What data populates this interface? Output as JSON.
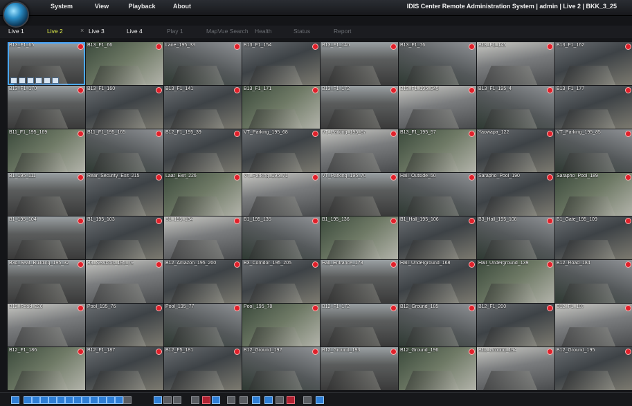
{
  "menu": [
    "System",
    "View",
    "Playback",
    "About"
  ],
  "app_title": "IDIS Center Remote Administration System | admin | Live 2 | BKK_3_25",
  "tabs": [
    {
      "label": "Live 1",
      "state": "normal"
    },
    {
      "label": "Live 2",
      "state": "active"
    },
    {
      "label": "Live 3",
      "state": "normal"
    },
    {
      "label": "Live 4",
      "state": "normal"
    },
    {
      "label": "Play 1",
      "state": "disabled"
    },
    {
      "label": "MapVue Search",
      "state": "disabled"
    },
    {
      "label": "Health",
      "state": "disabled"
    },
    {
      "label": "Status",
      "state": "disabled"
    },
    {
      "label": "Report",
      "state": "disabled"
    }
  ],
  "tab_close": "×",
  "cameras": [
    "B13_F1_65",
    "B13_F1_66",
    "Lane_195_33",
    "B13_F1_154",
    "B13_F1_140",
    "B13_F1_76",
    "B13_F1_145",
    "B13_F1_162",
    "B13_F1_170",
    "B13_F1_160",
    "B13_F1_141",
    "B13_F1_171",
    "B13_F1_172",
    "B13_F1_195_345",
    "B13_F1_195_4",
    "B13_F1_177",
    "B11_F1_195_169",
    "B11_F1_195_165",
    "B12_F1_195_39",
    "VT_Parking_195_68",
    "VT_Parking_195_67",
    "B13_F1_195_57",
    "Yaowapa_122",
    "VT_Parking_195_85",
    "B1_195_111",
    "Rear_Security_Exit_215",
    "Laat_Exit_226",
    "VT_Parking_195_71",
    "VT_Parking_195_70",
    "Hall_Outside_50",
    "Sarapho_Pool_190",
    "Sarapho_Pool_189",
    "B1_195_104",
    "B1_195_103",
    "B1_195_134",
    "B1_195_135",
    "B1_195_136",
    "B1_Hall_195_106",
    "B3_Hall_195_108",
    "B1_Gate_195_109",
    "B3d_Seat_Building_195_32",
    "B3_Seatbois_195_79",
    "B12_Amazon_195_200",
    "B3_Corridor_195_205",
    "Hall_Entrance_173",
    "Hall_Underground_168",
    "Hall_Underground_139",
    "B12_Road_184",
    "B12_Road_226",
    "Pool_195_76",
    "Pool_195_77",
    "Pool_195_78",
    "B12_F1_172",
    "B12_Ground_185",
    "B12_F1_200",
    "B12_F1_187",
    "B12_F1_186",
    "B12_F1_187",
    "B12_F5_181",
    "B12_Ground_192",
    "B12_Ground_193",
    "B12_Ground_196",
    "B12_Ground_194",
    "B12_Ground_195"
  ],
  "selected_camera": "B13_F1_65"
}
